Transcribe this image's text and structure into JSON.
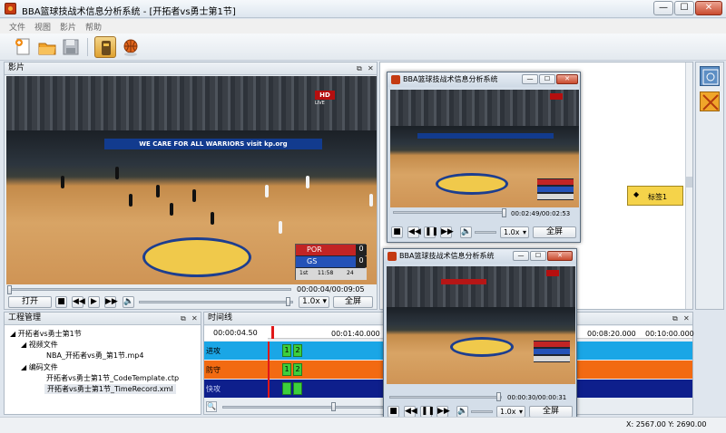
{
  "window": {
    "title": "BBA篮球技战术信息分析系统 - [开拓者vs勇士第1节]",
    "minimize": "—",
    "maximize": "☐",
    "close": "✕"
  },
  "menu": [
    "文件",
    "视图",
    "影片",
    "帮助"
  ],
  "video_panel": {
    "title": "影片",
    "time": "00:00:04/00:09:05",
    "open_label": "打开",
    "speed": "1.0x",
    "fullscreen_label": "全屏"
  },
  "broadcast": {
    "hd": "HD",
    "live": "LIVE",
    "ad": "WE CARE FOR ALL WARRIORS  visit kp.org",
    "team1": "POR",
    "score1": "0",
    "team2": "GS",
    "score2": "0",
    "period": "1st",
    "clock": "11:58",
    "shot_clock": "24"
  },
  "right_panel": {
    "tag_label": "标签1"
  },
  "project_panel": {
    "title": "工程管理",
    "items": [
      "开拓者vs勇士第1节",
      "视频文件",
      "NBA_开拓者vs勇_第1节.mp4",
      "编码文件",
      "开拓者vs勇士第1节_CodeTemplate.ctp",
      "开拓者vs勇士第1节_TimeRecord.xml"
    ]
  },
  "timeline_panel": {
    "title": "时间线",
    "current_time": "00:00:04.50",
    "ruler_labels": [
      "00:01:40.000",
      "00:08:20.000",
      "00:10:00.000"
    ],
    "rows": [
      {
        "label": "进攻",
        "color": "#1aa6e6",
        "marks": [
          "1",
          "2"
        ]
      },
      {
        "label": "防守",
        "color": "#f26a12",
        "marks": [
          "1",
          "2"
        ]
      },
      {
        "label": "快攻"
      }
    ]
  },
  "popup1": {
    "title": "BBA篮球技战术信息分析系统",
    "time": "00:02:49/00:02:53",
    "speed": "1.0x",
    "fullscreen_label": "全屏"
  },
  "popup2": {
    "title": "BBA篮球技战术信息分析系统",
    "time": "00:00:30/00:00:31",
    "speed": "1.0x",
    "fullscreen_label": "全屏"
  },
  "status": {
    "coords": "X: 2567.00  Y: 2690.00"
  }
}
